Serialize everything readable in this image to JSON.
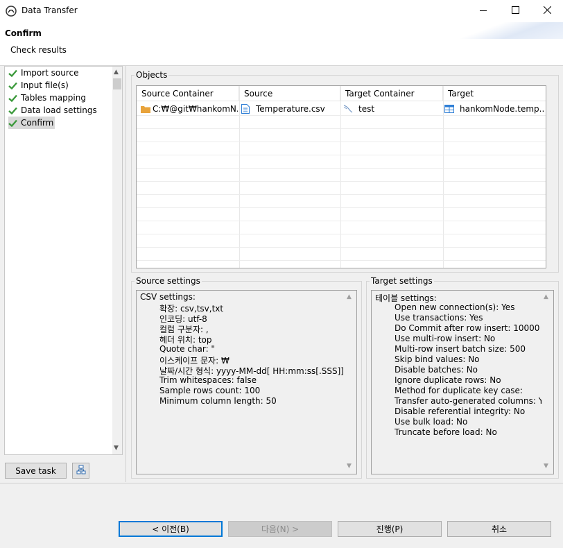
{
  "window": {
    "title": "Data Transfer",
    "controls": [
      "minimize-icon",
      "maximize-icon",
      "close-icon"
    ]
  },
  "header": {
    "title": "Confirm",
    "subtitle": "Check results"
  },
  "nav": {
    "items": [
      {
        "label": "Import source",
        "icon": "check-icon",
        "selected": false
      },
      {
        "label": "Input file(s)",
        "icon": "check-icon",
        "selected": false
      },
      {
        "label": "Tables mapping",
        "icon": "check-icon",
        "selected": false
      },
      {
        "label": "Data load settings",
        "icon": "check-icon",
        "selected": false
      },
      {
        "label": "Confirm",
        "icon": "check-icon",
        "selected": true
      }
    ],
    "save_task_label": "Save task"
  },
  "objects": {
    "group_label": "Objects",
    "columns": [
      "Source Container",
      "Source",
      "Target Container",
      "Target"
    ],
    "rows": [
      {
        "source_container": "C:₩@git₩hankomN...",
        "source": "Temperature.csv",
        "target_container": "test",
        "target": "hankomNode.temp..."
      }
    ]
  },
  "source_settings": {
    "group_label": "Source settings",
    "header": "CSV settings:",
    "lines": [
      "확장: csv,tsv,txt",
      "인코딩: utf-8",
      "컬럼 구분자: ,",
      "헤더 위치: top",
      "Quote char: \"",
      "이스케이프 문자: ₩",
      "날짜/시간 형식: yyyy-MM-dd[ HH:mm:ss[.SSS]]",
      "Trim whitespaces: false",
      "Sample rows count: 100",
      "Minimum column length: 50"
    ]
  },
  "target_settings": {
    "group_label": "Target settings",
    "header": "테이블 settings:",
    "lines": [
      "Open new connection(s): Yes",
      "Use transactions: Yes",
      "Do Commit after row insert: 10000",
      "Use multi-row insert: No",
      "Multi-row insert batch size: 500",
      "Skip bind values: No",
      "Disable batches: No",
      "Ignore duplicate rows: No",
      "Method for duplicate key case:",
      "Transfer auto-generated columns: Yes",
      "Disable referential integrity: No",
      "Use bulk load: No",
      "Truncate before load: No"
    ]
  },
  "buttons": {
    "back": "< 이전(B)",
    "next": "다음(N) >",
    "proceed": "진행(P)",
    "cancel": "취소"
  },
  "colors": {
    "check": "#3c9a3c",
    "folder": "#e8a33b",
    "table_icon": "#2f7fd6",
    "default_button_border": "#0078d7"
  }
}
